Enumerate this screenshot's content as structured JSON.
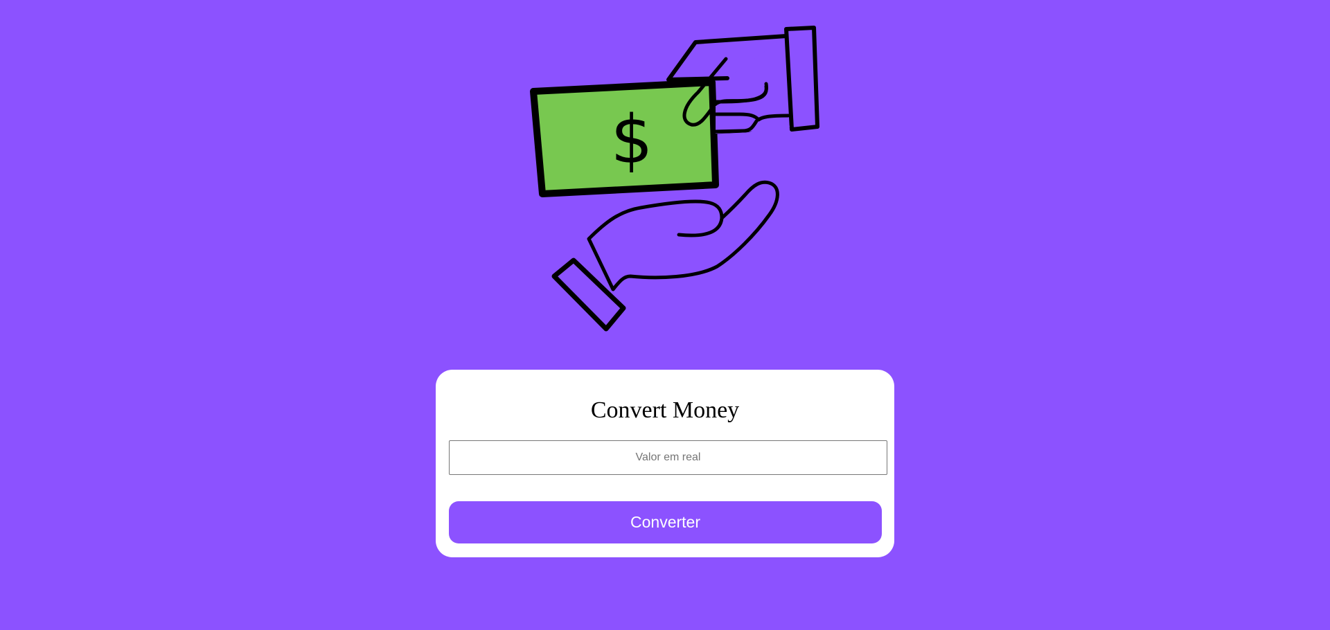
{
  "colors": {
    "background": "#8c52ff",
    "card": "#ffffff",
    "button": "#8c52ff",
    "bill": "#78c850"
  },
  "illustration": {
    "icon": "hand-giving-money-icon",
    "bill_symbol": "$"
  },
  "converter": {
    "title": "Convert Money",
    "input_placeholder": "Valor em real",
    "input_value": "",
    "button_label": "Converter"
  }
}
